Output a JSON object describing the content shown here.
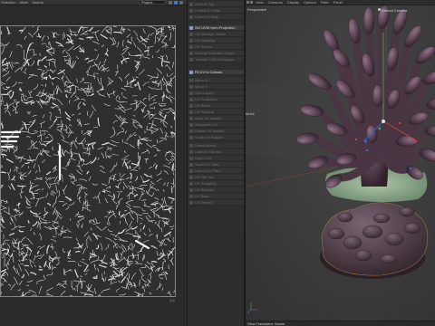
{
  "uv_editor": {
    "menu": [
      "Selection",
      "Mesh",
      "Seams"
    ],
    "dropdown_value": "Project",
    "corner_label": "1,0"
  },
  "command_panel": {
    "items": [
      {
        "label": "Add UV Tag",
        "icon": "tag-icon",
        "active": false
      },
      {
        "label": "Frontal UV Map",
        "icon": "cube-icon",
        "active": false
      },
      {
        "label": "Cubic UV Map",
        "icon": "cube-icon",
        "active": false
      },
      {
        "label": "Set UVW from Projection",
        "icon": "projection-icon",
        "active": true
      },
      {
        "label": "UV Manager Editor",
        "icon": "grid-icon",
        "active": false
      },
      {
        "label": "UV Mapping",
        "icon": "grid-icon",
        "active": false
      },
      {
        "label": "UV Seams",
        "icon": "seam-icon",
        "active": false
      },
      {
        "label": "Unwrap Selection Edges",
        "icon": "unwrap-icon",
        "active": false
      },
      {
        "label": "Transfer UVs to Polygon",
        "icon": "transfer-icon",
        "active": false
      },
      {
        "label": "Fit UV to Canvas",
        "icon": "fit-icon",
        "active": true
      },
      {
        "label": "Mirror U",
        "icon": "mirror-icon",
        "active": false
      },
      {
        "label": "Mirror V",
        "icon": "mirror-icon",
        "active": false
      },
      {
        "label": "Grid Layout",
        "icon": "grid-icon",
        "active": false
      },
      {
        "label": "UV Projection",
        "icon": "projection-icon",
        "active": false
      },
      {
        "label": "UV Relax",
        "icon": "relax-icon",
        "active": false
      },
      {
        "label": "UV Packing",
        "icon": "pack-icon",
        "active": false
      },
      {
        "label": "Align UV Islands",
        "icon": "align-icon",
        "active": false
      },
      {
        "label": "Straighten UV",
        "icon": "straighten-icon",
        "active": false
      },
      {
        "label": "Rotate UV Islands",
        "icon": "rotate-icon",
        "active": false
      },
      {
        "label": "Scale UV Islands",
        "icon": "scale-icon",
        "active": false
      },
      {
        "label": "Select Island",
        "icon": "select-icon",
        "active": false
      },
      {
        "label": "Lock UV Islands",
        "icon": "lock-icon",
        "active": false
      },
      {
        "label": "Layer UVs",
        "icon": "layer-icon",
        "active": false
      },
      {
        "label": "Stack UV Tiles",
        "icon": "stack-icon",
        "active": false
      },
      {
        "label": "Layout UV Tiles",
        "icon": "layout-icon",
        "active": false
      },
      {
        "label": "UV Tile Tool",
        "icon": "tile-icon",
        "active": false
      },
      {
        "label": "UV Snapping",
        "icon": "snap-icon",
        "active": false
      },
      {
        "label": "UV Retouch",
        "icon": "brush-icon",
        "active": false
      },
      {
        "label": "UV Bake",
        "icon": "bake-icon",
        "active": false
      },
      {
        "label": "UV Terrain",
        "icon": "terrain-icon",
        "active": false
      }
    ]
  },
  "viewport": {
    "menu": [
      "View",
      "Cameras",
      "Display",
      "Options",
      "Filter",
      "Panel"
    ],
    "projection": "Perspective",
    "camera": "Default Camera",
    "tool": "Move",
    "footer": "View Transform: Scene"
  }
}
